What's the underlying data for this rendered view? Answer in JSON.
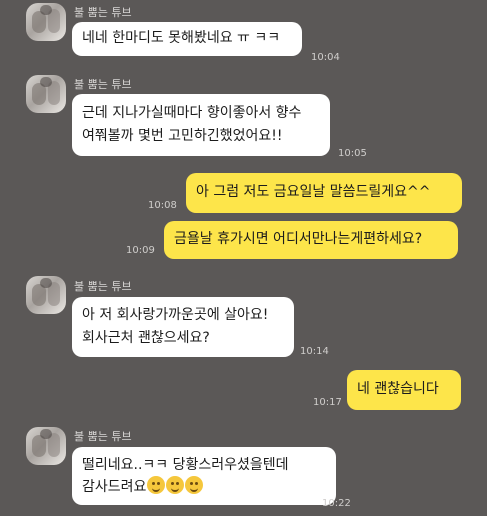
{
  "sender_name": "불 뿜는 튜브",
  "messages": [
    {
      "direction": "in",
      "lines": [
        "네네 한마디도 못해봤네요 ㅠ ㅋㅋ"
      ],
      "time": "10:04"
    },
    {
      "direction": "in",
      "lines": [
        "근데 지나가실때마다 향이좋아서 향수",
        "여쭤볼까 몇번 고민하긴했었어요!!"
      ],
      "time": "10:05"
    },
    {
      "direction": "out",
      "lines": [
        "아 그럼 저도 금요일날 말씀드릴게요^^"
      ],
      "time": "10:08"
    },
    {
      "direction": "out",
      "lines": [
        "금욜날 휴가시면 어디서만나는게편하세요?"
      ],
      "time": "10:09"
    },
    {
      "direction": "in",
      "lines": [
        "아 저 회사랑가까운곳에 살아요!",
        "회사근처 괜찮으세요?"
      ],
      "time": "10:14"
    },
    {
      "direction": "out",
      "lines": [
        "네 괜찮습니다"
      ],
      "time": "10:17"
    },
    {
      "direction": "in",
      "lines": [
        "떨리네요..ㅋㅋ 당황스러우셨을텐데",
        "감사드려요"
      ],
      "time": "10:22",
      "emoji": [
        "smiling-face-emoji",
        "smiling-face-emoji",
        "smiling-face-emoji"
      ]
    }
  ]
}
